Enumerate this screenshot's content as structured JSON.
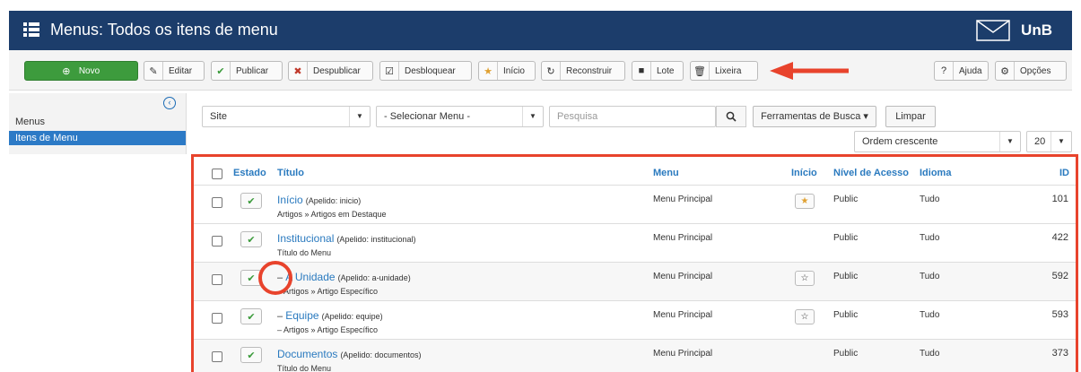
{
  "header": {
    "title": "Menus: Todos os itens de menu",
    "logo_text": "UnB"
  },
  "toolbar": {
    "new_label": "Novo",
    "edit_label": "Editar",
    "publish_label": "Publicar",
    "unpublish_label": "Despublicar",
    "unlock_label": "Desbloquear",
    "home_label": "Início",
    "rebuild_label": "Reconstruir",
    "batch_label": "Lote",
    "trash_label": "Lixeira",
    "help_label": "Ajuda",
    "options_label": "Opções"
  },
  "sidebar": {
    "items": [
      {
        "label": "Menus"
      },
      {
        "label": "Itens de Menu"
      }
    ]
  },
  "filters": {
    "site": "Site",
    "menu_select": "- Selecionar Menu -",
    "search_placeholder": "Pesquisa",
    "search_tools": "Ferramentas de Busca ▾",
    "clear": "Limpar",
    "ordering": "Ordem crescente",
    "limit": "20"
  },
  "table": {
    "headers": {
      "status": "Estado",
      "title": "Título",
      "menu": "Menu",
      "home": "Início",
      "access": "Nível de Acesso",
      "language": "Idioma",
      "id": "ID"
    },
    "rows": [
      {
        "prefix": "",
        "title": "Início",
        "alias": "(Apelido: inicio)",
        "subtitle": "Artigos » Artigos em Destaque",
        "menu": "Menu Principal",
        "home_icon": "star-filled-icon",
        "access": "Public",
        "language": "Tudo",
        "id": "101"
      },
      {
        "prefix": "",
        "title": "Institucional",
        "alias": "(Apelido: institucional)",
        "subtitle": "Título do Menu",
        "menu": "Menu Principal",
        "home_icon": "",
        "access": "Public",
        "language": "Tudo",
        "id": "422"
      },
      {
        "prefix": "– ",
        "title": "A Unidade",
        "alias": "(Apelido: a-unidade)",
        "subtitle": "– Artigos » Artigo Específico",
        "menu": "Menu Principal",
        "home_icon": "star-outline-icon",
        "access": "Public",
        "language": "Tudo",
        "id": "592"
      },
      {
        "prefix": "– ",
        "title": "Equipe",
        "alias": "(Apelido: equipe)",
        "subtitle": "– Artigos » Artigo Específico",
        "menu": "Menu Principal",
        "home_icon": "star-outline-icon",
        "access": "Public",
        "language": "Tudo",
        "id": "593"
      },
      {
        "prefix": "",
        "title": "Documentos",
        "alias": "(Apelido: documentos)",
        "subtitle": "Título do Menu",
        "menu": "Menu Principal",
        "home_icon": "",
        "access": "Public",
        "language": "Tudo",
        "id": "373"
      }
    ]
  },
  "colors": {
    "header_bg": "#1c3d6b",
    "accent": "#2a7abf",
    "highlight": "#e8432c",
    "new_button": "#3d9b3d"
  }
}
